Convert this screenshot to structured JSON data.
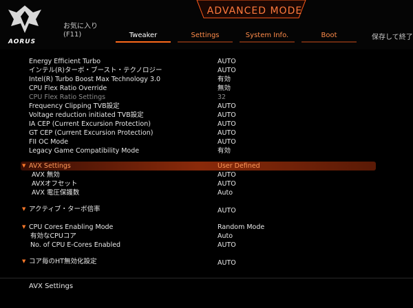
{
  "header": {
    "brand": "AORUS",
    "mode_title": "ADVANCED MODE",
    "favorites_label": "お気に入り",
    "favorites_key": "(F11)",
    "tabs": [
      {
        "label": "Tweaker",
        "active": true
      },
      {
        "label": "Settings",
        "active": false
      },
      {
        "label": "System Info.",
        "active": false
      },
      {
        "label": "Boot",
        "active": false
      }
    ],
    "save_exit": "保存して終了"
  },
  "settings": [
    {
      "label": "Energy Efficient Turbo",
      "value": "AUTO"
    },
    {
      "label": "インテル(R)ターボ・ブースト・テクノロジー",
      "value": "AUTO"
    },
    {
      "label": "Intel(R) Turbo Boost Max Technology 3.0",
      "value": "有効"
    },
    {
      "label": "CPU Flex Ratio Override",
      "value": "無効"
    },
    {
      "label": "CPU Flex Ratio Settings",
      "value": "32",
      "disabled": true
    },
    {
      "label": "Frequency Clipping TVB設定",
      "value": "AUTO"
    },
    {
      "label": "Voltage reduction initiated TVB設定",
      "value": "AUTO"
    },
    {
      "label": "IA CEP (Current Excursion Protection)",
      "value": "AUTO"
    },
    {
      "label": "GT CEP (Current Excursion Protection)",
      "value": "AUTO"
    },
    {
      "label": "FII OC Mode",
      "value": "AUTO"
    },
    {
      "label": "Legacy Game Compatibility Mode",
      "value": "有効"
    }
  ],
  "avx": {
    "label": "AVX Settings",
    "value": "User Defined",
    "items": [
      {
        "label": "AVX 無効",
        "value": "AUTO"
      },
      {
        "label": "AVXオフセット",
        "value": "AUTO"
      },
      {
        "label": "AVX 電圧保護数",
        "value": "Auto"
      }
    ]
  },
  "active_turbo": {
    "label": "アクティブ・ターボ倍率",
    "value": "AUTO"
  },
  "cpu_cores": {
    "label": "CPU Cores Enabling Mode",
    "value": "Random Mode",
    "items": [
      {
        "label": "有効なCPUコア",
        "value": "Auto"
      },
      {
        "label": "No. of CPU E-Cores Enabled",
        "value": "AUTO"
      }
    ]
  },
  "ht": {
    "label": "コア毎のHT無効化設定",
    "value": "AUTO"
  },
  "footer": {
    "help_text": "AVX Settings"
  },
  "colors": {
    "accent": "#ff6a1a",
    "highlight": "#8a2a0a"
  }
}
